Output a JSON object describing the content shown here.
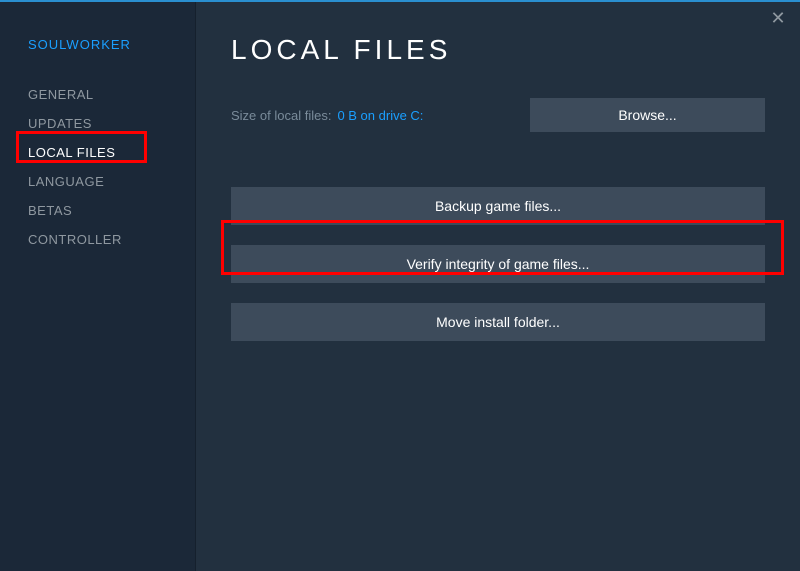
{
  "game_title": "SOULWORKER",
  "sidebar": {
    "items": [
      {
        "label": "GENERAL"
      },
      {
        "label": "UPDATES"
      },
      {
        "label": "LOCAL FILES"
      },
      {
        "label": "LANGUAGE"
      },
      {
        "label": "BETAS"
      },
      {
        "label": "CONTROLLER"
      }
    ]
  },
  "main": {
    "title": "LOCAL FILES",
    "size_label": "Size of local files:",
    "size_value": "0 B on drive C:",
    "browse_label": "Browse...",
    "backup_label": "Backup game files...",
    "verify_label": "Verify integrity of game files...",
    "move_label": "Move install folder..."
  }
}
